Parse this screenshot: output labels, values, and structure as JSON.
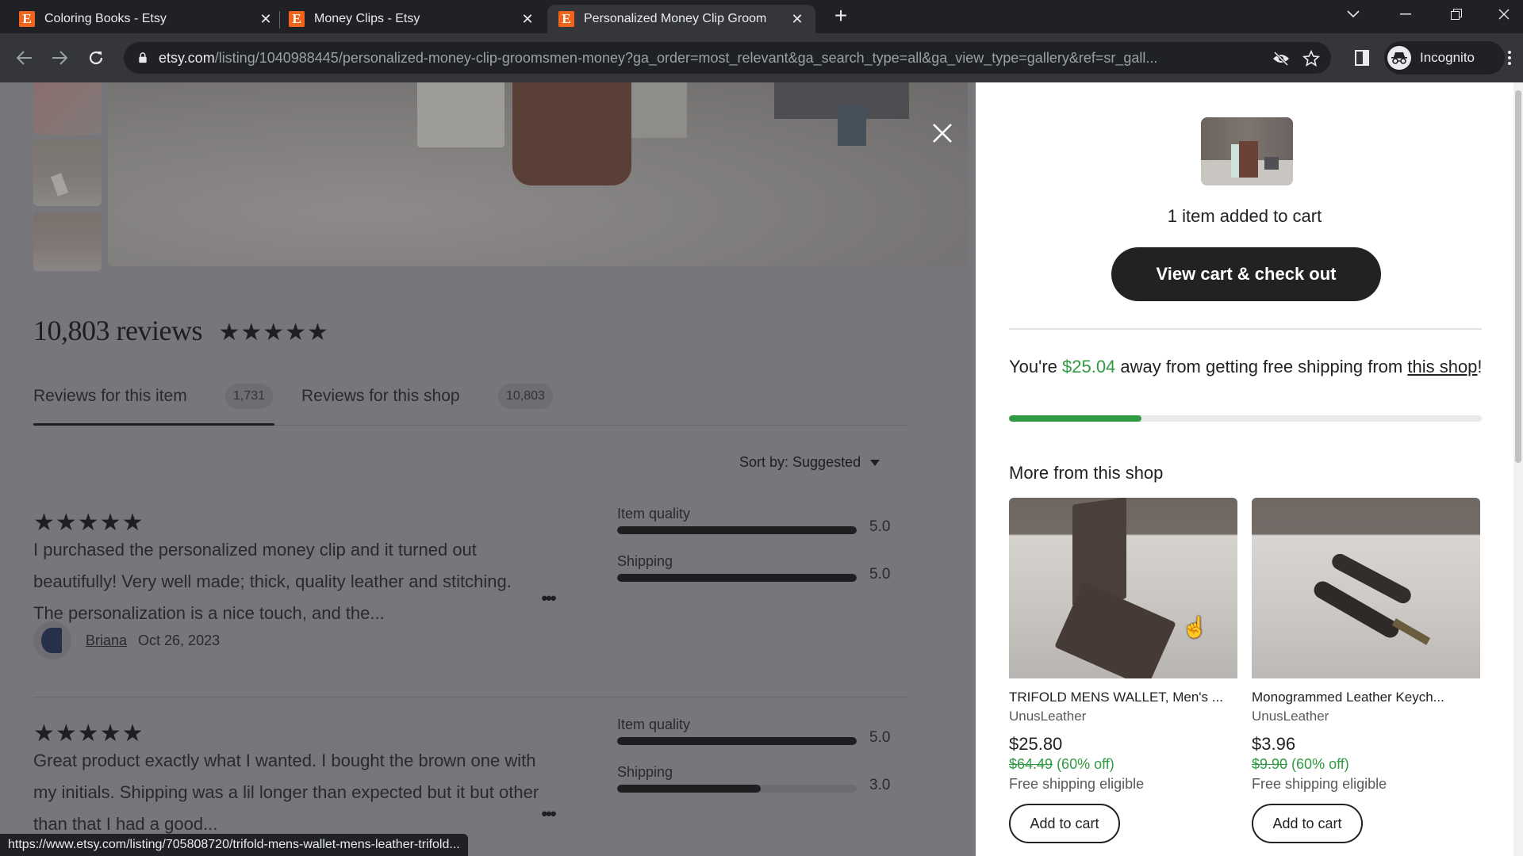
{
  "browser": {
    "tabs": [
      {
        "title": "Coloring Books - Etsy",
        "favicon": "E",
        "active": false
      },
      {
        "title": "Money Clips - Etsy",
        "favicon": "E",
        "active": false
      },
      {
        "title": "Personalized Money Clip Groom",
        "favicon": "E",
        "active": true
      }
    ],
    "new_tab_label": "+",
    "url_host": "etsy.com",
    "url_path": "/listing/1040988445/personalized-money-clip-groomsmen-money?ga_order=most_relevant&ga_search_type=all&ga_view_type=gallery&ref=sr_gall...",
    "profile_label": "Incognito",
    "status_url": "https://www.etsy.com/listing/705808720/trifold-mens-wallet-mens-leather-trifold..."
  },
  "reviews": {
    "heading": "10,803 reviews",
    "rating_stars": "★★★★★",
    "tabs": [
      {
        "label": "Reviews for this item",
        "count": "1,731",
        "active": true
      },
      {
        "label": "Reviews for this shop",
        "count": "10,803",
        "active": false
      }
    ],
    "sort_label": "Sort by: Suggested",
    "items": [
      {
        "stars": "★★★★★",
        "text": "I purchased the personalized money clip and it turned out beautifully! Very well made; thick, quality leather and stitching. The personalization is a nice touch, and the...",
        "more_label": "•••",
        "reviewer": "Briana",
        "date": "Oct 26, 2023",
        "sub_ratings": [
          {
            "label": "Item quality",
            "value": "5.0",
            "fraction": 1.0
          },
          {
            "label": "Shipping",
            "value": "5.0",
            "fraction": 1.0
          }
        ]
      },
      {
        "stars": "★★★★★",
        "text": "Great product exactly what I wanted. I bought the brown one with my initials. Shipping was a lil longer than expected but it but other than that I had a good...",
        "more_label": "•••",
        "sub_ratings": [
          {
            "label": "Item quality",
            "value": "5.0",
            "fraction": 1.0
          },
          {
            "label": "Shipping",
            "value": "3.0",
            "fraction": 0.6
          }
        ]
      }
    ]
  },
  "cart_panel": {
    "added_text": "1 item added to cart",
    "checkout_label": "View cart & check out",
    "shipping_prefix": "You're ",
    "shipping_amount": "$25.04",
    "shipping_middle": " away from getting free shipping from ",
    "shipping_link": "this shop",
    "shipping_suffix": "!",
    "shipping_progress": 0.28,
    "more_title": "More from this shop",
    "products": [
      {
        "title": "TRIFOLD MENS WALLET, Men's ...",
        "shop": "UnusLeather",
        "price": "$25.80",
        "original_price": "$64.49",
        "discount": " (60% off)",
        "shipping": "Free shipping eligible",
        "add_label": "Add to cart"
      },
      {
        "title": "Monogrammed Leather Keych...",
        "shop": "UnusLeather",
        "price": "$3.96",
        "original_price": "$9.90",
        "discount": " (60% off)",
        "shipping": "Free shipping eligible",
        "add_label": "Add to cart"
      }
    ]
  },
  "colors": {
    "etsy_orange": "#f1641e",
    "success_green": "#2f9a41",
    "button_dark": "#222222"
  }
}
